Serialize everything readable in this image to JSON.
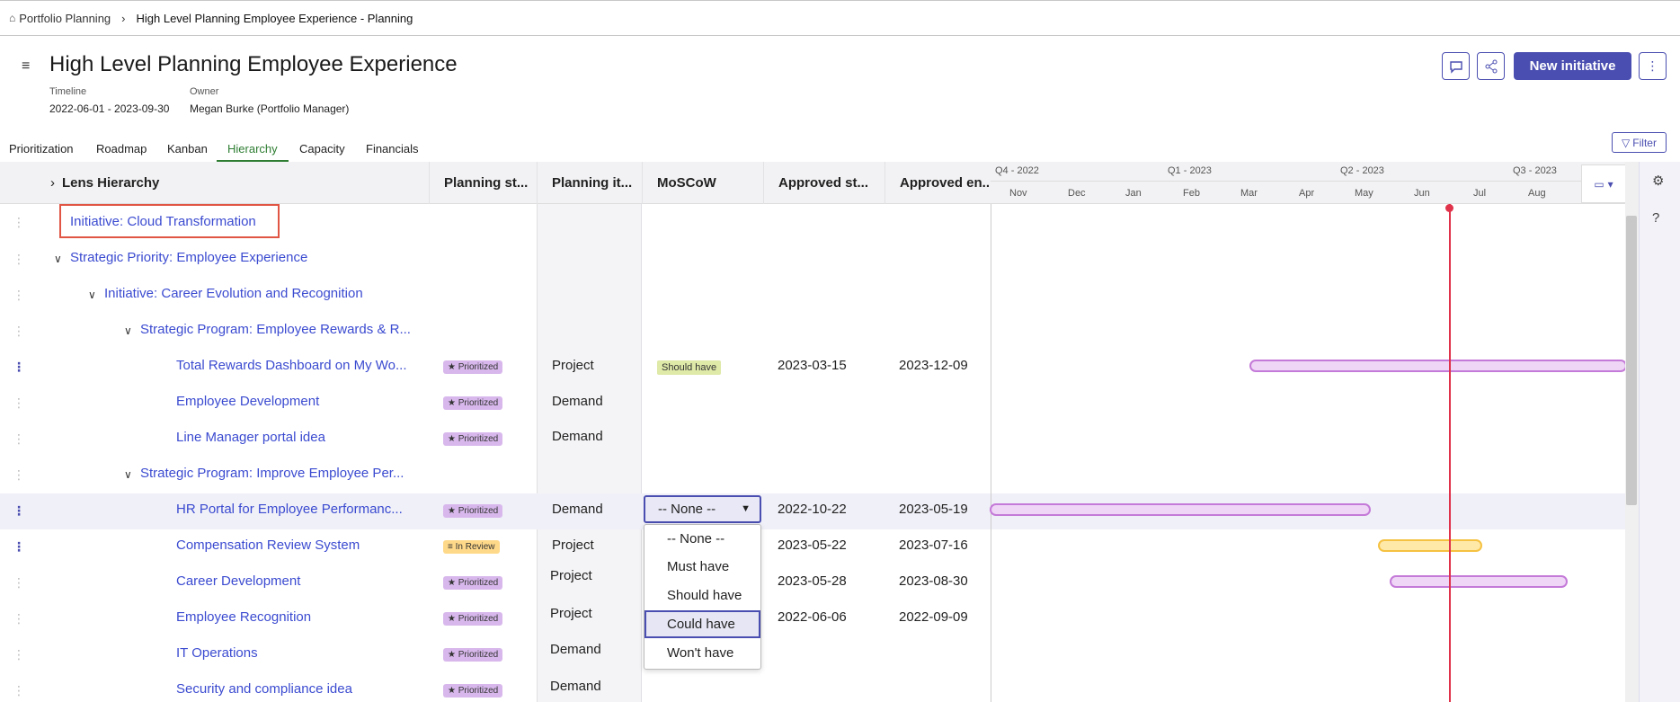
{
  "breadcrumb": {
    "home": "Portfolio Planning",
    "current": "High Level Planning Employee Experience - Planning"
  },
  "page": {
    "title": "High Level Planning Employee Experience",
    "timeline_label": "Timeline",
    "timeline_value": "2022-06-01 - 2023-09-30",
    "owner_label": "Owner",
    "owner_value": "Megan Burke (Portfolio Manager)",
    "new_initiative": "New initiative"
  },
  "tabs": [
    "Prioritization",
    "Roadmap",
    "Kanban",
    "Hierarchy",
    "Capacity",
    "Financials"
  ],
  "active_tab": "Hierarchy",
  "filter_label": "Filter",
  "columns": [
    "Lens Hierarchy",
    "Planning st...",
    "Planning it...",
    "MoSCoW",
    "Approved st...",
    "Approved en..."
  ],
  "gantt": {
    "quarters": [
      "Q4 - 2022",
      "Q1 - 2023",
      "Q2 - 2023",
      "Q3 - 2023"
    ],
    "months": [
      "Nov",
      "Dec",
      "Jan",
      "Feb",
      "Mar",
      "Apr",
      "May",
      "Jun",
      "Jul",
      "Aug"
    ]
  },
  "rows": [
    {
      "name": "Initiative: Cloud Transformation"
    },
    {
      "name": "Strategic Priority: Employee Experience"
    },
    {
      "name": "Initiative: Career Evolution and Recognition"
    },
    {
      "name": "Strategic Program: Employee Rewards & R..."
    },
    {
      "name": "Total Rewards Dashboard on My Wo...",
      "status": "Prioritized",
      "item": "Project",
      "moscow": "Should have",
      "start": "2023-03-15",
      "end": "2023-12-09"
    },
    {
      "name": "Employee Development",
      "status": "Prioritized",
      "item": "Demand"
    },
    {
      "name": "Line Manager portal idea",
      "status": "Prioritized",
      "item": "Demand"
    },
    {
      "name": "Strategic Program: Improve Employee Per..."
    },
    {
      "name": "HR Portal for Employee Performanc...",
      "status": "Prioritized",
      "item": "Demand",
      "start": "2022-10-22",
      "end": "2023-05-19"
    },
    {
      "name": "Compensation Review System",
      "status": "In Review",
      "item": "Project",
      "start": "2023-05-22",
      "end": "2023-07-16"
    },
    {
      "name": "Career Development",
      "status": "Prioritized",
      "item": "Project",
      "start": "2023-05-28",
      "end": "2023-08-30"
    },
    {
      "name": "Employee Recognition",
      "status": "Prioritized",
      "item": "Project",
      "start": "2022-06-06",
      "end": "2022-09-09"
    },
    {
      "name": "IT Operations",
      "status": "Prioritized",
      "item": "Demand"
    },
    {
      "name": "Security and compliance idea",
      "status": "Prioritized",
      "item": "Demand"
    }
  ],
  "moscow_select": {
    "value": "-- None --",
    "options": [
      "-- None --",
      "Must have",
      "Should have",
      "Could have",
      "Won't have"
    ],
    "highlighted": "Could have"
  },
  "colors": {
    "accent": "#4a4eb0",
    "link": "#3b4bd0",
    "today": "#e0334b",
    "prioritized": "#d8b8ec",
    "in_review": "#ffd98a"
  }
}
